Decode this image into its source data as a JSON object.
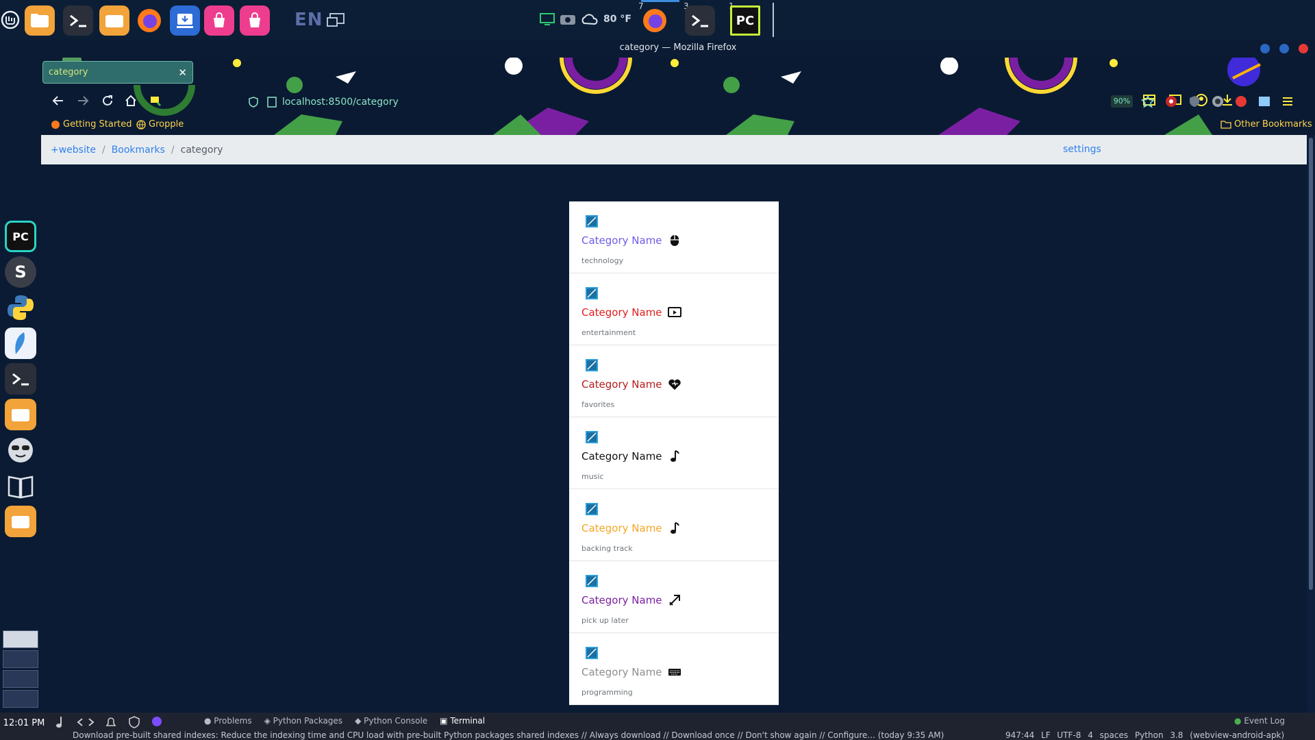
{
  "system_panel": {
    "keyboard_layout": "EN",
    "weather": "80 °F",
    "workspace_numbers": [
      "7",
      "3",
      "1"
    ],
    "pycharm_label": "PC"
  },
  "window": {
    "title": "category — Mozilla Firefox"
  },
  "tab": {
    "label": "category",
    "close": "✕"
  },
  "address_bar": {
    "url": "localhost:8500/category",
    "zoom": "90%"
  },
  "bookmarks_bar": {
    "items": [
      "Getting Started",
      "Gropple"
    ],
    "other": "Other Bookmarks"
  },
  "breadcrumb": {
    "items": [
      "+website",
      "Bookmarks"
    ],
    "current": "category",
    "settings": "settings"
  },
  "categories": [
    {
      "title": "Category Name",
      "desc": "technology",
      "color": "#6c5ce7",
      "icon": "mouse-icon"
    },
    {
      "title": "Category Name",
      "desc": "entertainment",
      "color": "#e11d1d",
      "icon": "tv-icon"
    },
    {
      "title": "Category Name",
      "desc": "favorites",
      "color": "#b71c1c",
      "icon": "heart-icon"
    },
    {
      "title": "Category Name",
      "desc": "music",
      "color": "#111111",
      "icon": "music-note-icon"
    },
    {
      "title": "Category Name",
      "desc": "backing track",
      "color": "#f5a623",
      "icon": "music-note-icon"
    },
    {
      "title": "Category Name",
      "desc": "pick up later",
      "color": "#7b1fa2",
      "icon": "arrow-icon"
    },
    {
      "title": "Category Name",
      "desc": "programming",
      "color": "#8d8d8d",
      "icon": "keyboard-icon"
    }
  ],
  "ide": {
    "clock": "12:01 PM",
    "tabs": [
      "Problems",
      "Python Packages",
      "Python Console",
      "Terminal"
    ],
    "active_tab": "Terminal",
    "event_log": "Event Log",
    "notification": "Download pre-built shared indexes: Reduce the indexing time and CPU load with pre-built Python packages shared indexes // Always download // Download once // Don't show again // Configure... (today 9:35 AM)",
    "status": "947:44  LF  UTF-8  4 spaces  Python 3.8 (webview-android-apk)"
  }
}
